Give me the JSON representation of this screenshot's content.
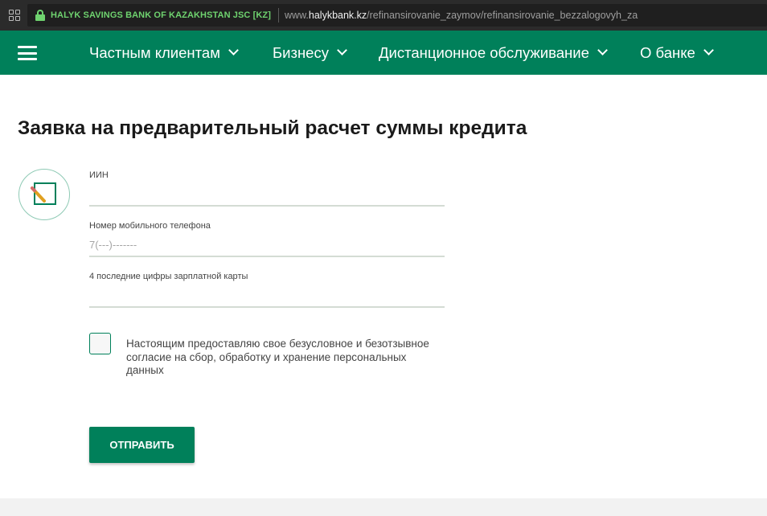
{
  "browser": {
    "ev_name": "HALYK SAVINGS BANK OF KAZAKHSTAN JSC [KZ]",
    "url_prefix": "www.",
    "url_host": "halykbank.kz",
    "url_path": "/refinansirovanie_zaymov/refinansirovanie_bezzalogovyh_za"
  },
  "nav": {
    "items": [
      {
        "label": "Частным клиентам"
      },
      {
        "label": "Бизнесу"
      },
      {
        "label": "Дистанционное обслуживание"
      },
      {
        "label": "О банке"
      }
    ]
  },
  "form": {
    "title": "Заявка на предварительный расчет суммы кредита",
    "fields": [
      {
        "label": "ИИН",
        "value": "",
        "placeholder": ""
      },
      {
        "label": "Номер мобильного телефона",
        "value": "",
        "placeholder": "7(---)-------"
      },
      {
        "label": "4 последние цифры зарплатной карты",
        "value": "",
        "placeholder": ""
      }
    ],
    "consent_text": "Настоящим предоставляю свое безусловное и безотзывное согласие на сбор, обработку и хранение персональных данных",
    "consent_checked": false,
    "submit_label": "ОТПРАВИТЬ"
  },
  "colors": {
    "brand_green": "#00805a",
    "ev_green": "#6fd36f"
  }
}
